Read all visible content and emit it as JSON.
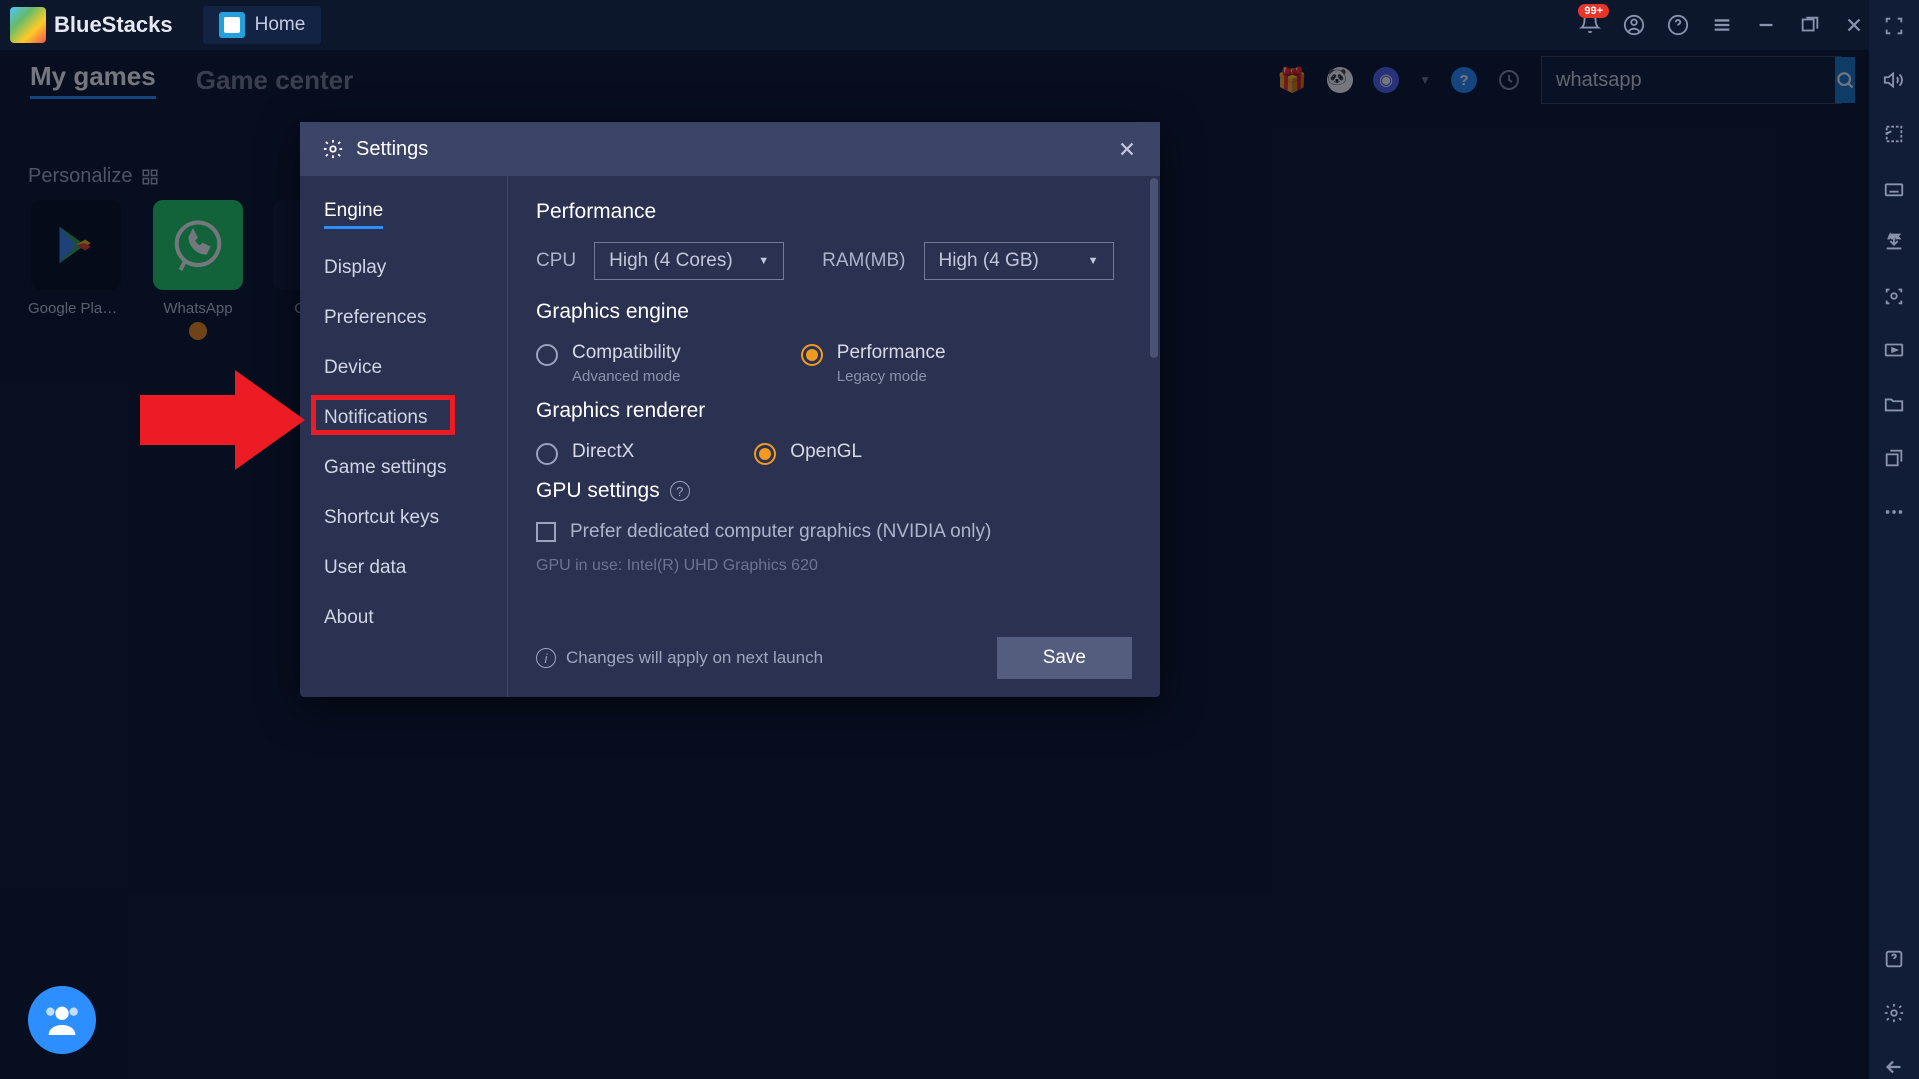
{
  "titlebar": {
    "brand": "BlueStacks",
    "home": "Home",
    "badge": "99+"
  },
  "subnav": {
    "tabs": [
      "My games",
      "Game center"
    ],
    "search_value": "whatsapp"
  },
  "personalize": "Personalize",
  "apps": [
    {
      "label": "Google Play ..."
    },
    {
      "label": "WhatsApp"
    },
    {
      "label": "Only ..."
    }
  ],
  "modal": {
    "title": "Settings",
    "nav": [
      "Engine",
      "Display",
      "Preferences",
      "Device",
      "Notifications",
      "Game settings",
      "Shortcut keys",
      "User data",
      "About"
    ],
    "content": {
      "perf_h": "Performance",
      "cpu_lbl": "CPU",
      "cpu_val": "High (4 Cores)",
      "ram_lbl": "RAM(MB)",
      "ram_val": "High (4 GB)",
      "gengine_h": "Graphics engine",
      "r1a": "Compatibility",
      "r1a_sub": "Advanced mode",
      "r1b": "Performance",
      "r1b_sub": "Legacy mode",
      "grend_h": "Graphics renderer",
      "r2a": "DirectX",
      "r2b": "OpenGL",
      "gpu_h": "GPU settings",
      "gpu_chk": "Prefer dedicated computer graphics (NVIDIA only)",
      "gpu_use": "GPU in use: Intel(R) UHD Graphics 620",
      "info": "Changes will apply on next launch",
      "save": "Save"
    }
  }
}
